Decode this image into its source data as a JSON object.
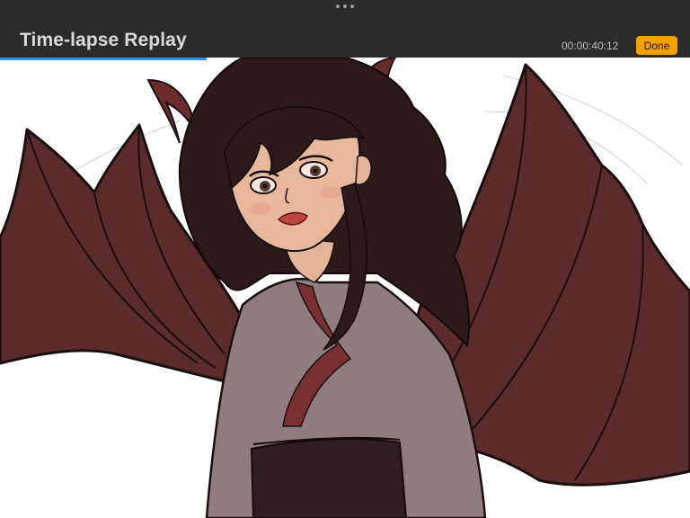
{
  "header": {
    "title": "Time-lapse Replay",
    "elapsed": "00:00:40:12",
    "done_label": "Done",
    "more_icon": "ellipsis-icon"
  },
  "replay": {
    "progress": 0.3
  },
  "colors": {
    "topbar": "#2b2b2b",
    "accent_done": "#f5a000",
    "progress": "#2f8cf3",
    "wing": "#5b2a2b",
    "robe": "#8f7c7f",
    "sash": "#2f1e21",
    "hair": "#2c1a1b",
    "skin": "#e8b89c"
  }
}
